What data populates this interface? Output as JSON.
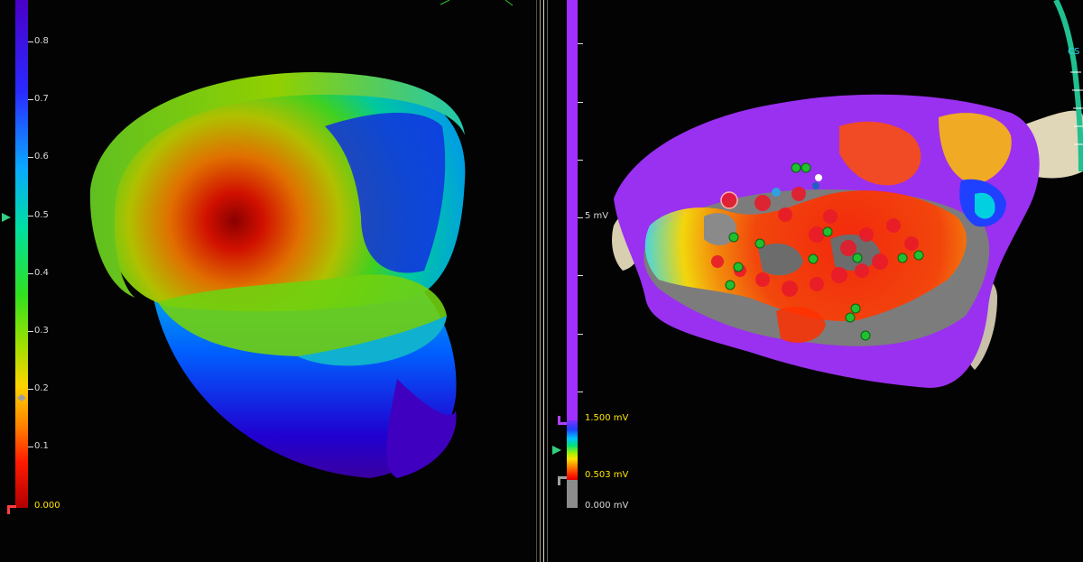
{
  "left_scale": {
    "labels": [
      "0.8",
      "0.7",
      "0.6",
      "0.5",
      "0.4",
      "0.3",
      "0.2",
      "0.1",
      "0.000"
    ]
  },
  "right_scale": {
    "mid_label": "5 mV",
    "upper_threshold": "1.500 mV",
    "lower_threshold": "0.503 mV",
    "zero_label": "0.000 mV"
  },
  "catheter_label": "CS"
}
